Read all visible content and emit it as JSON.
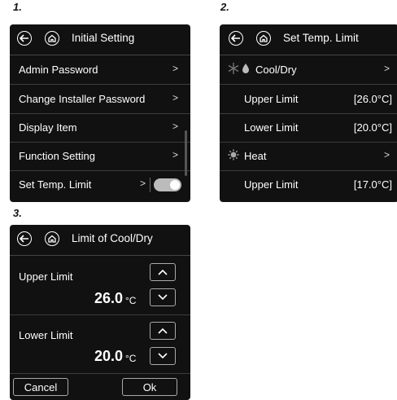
{
  "steps": {
    "one": "1.",
    "two": "2.",
    "three": "3."
  },
  "panel1": {
    "title": "Initial Setting",
    "items": [
      {
        "label": "Admin Password"
      },
      {
        "label": "Change Installer Password"
      },
      {
        "label": "Display Item"
      },
      {
        "label": "Function Setting"
      },
      {
        "label": "Set Temp. Limit",
        "toggle": "on"
      }
    ]
  },
  "panel2": {
    "title": "Set Temp. Limit",
    "cool_label": "Cool/Dry",
    "cool_upper_label": "Upper Limit",
    "cool_upper_value": "[26.0°C]",
    "cool_lower_label": "Lower Limit",
    "cool_lower_value": "[20.0°C]",
    "heat_label": "Heat",
    "heat_upper_label": "Upper Limit",
    "heat_upper_value": "[17.0°C]"
  },
  "panel3": {
    "title": "Limit of Cool/Dry",
    "upper_label": "Upper Limit",
    "upper_value": "26.0",
    "lower_label": "Lower Limit",
    "lower_value": "20.0",
    "unit": "°C",
    "cancel_label": "Cancel",
    "ok_label": "Ok"
  },
  "glyphs": {
    "chevron": ">"
  },
  "icons": {
    "back": "back-arrow-icon",
    "home": "home-icon",
    "cool": "snowflake-icon",
    "dry": "water-drop-icon",
    "heat": "sun-icon",
    "up": "chevron-up-icon",
    "down": "chevron-down-icon"
  },
  "colors": {
    "panel_bg": "#111111",
    "divider": "#3c3c3c",
    "toggle_on": "#bbbbbb",
    "muted_icon": "#777777"
  }
}
